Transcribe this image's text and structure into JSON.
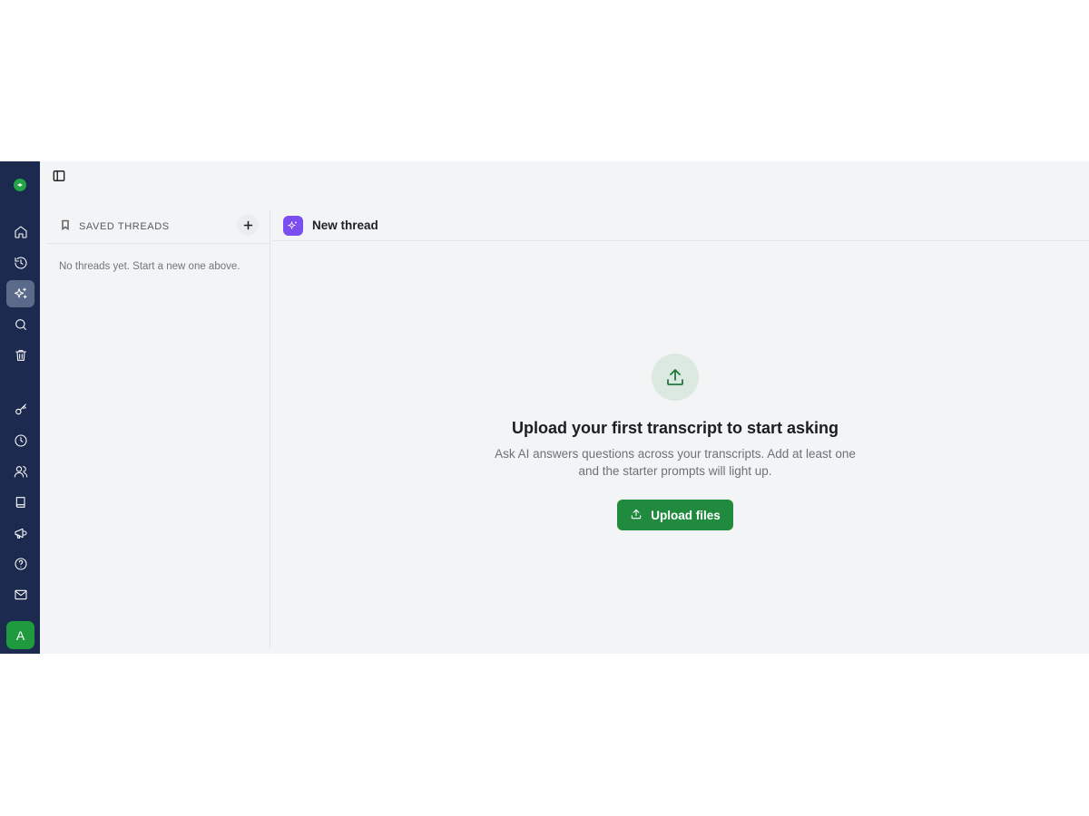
{
  "rail": {
    "avatar_initial": "A",
    "icons": [
      "logo-icon",
      "home-icon",
      "history-icon",
      "ai-sparkles-icon",
      "search-icon",
      "trash-icon",
      "key-icon",
      "clock-icon",
      "users-icon",
      "book-icon",
      "megaphone-icon",
      "help-icon",
      "mail-icon"
    ]
  },
  "threads": {
    "title": "SAVED THREADS",
    "empty_text": "No threads yet. Start a new one above."
  },
  "chat": {
    "title": "New thread",
    "empty_title": "Upload your first transcript to start asking",
    "empty_desc": "Ask AI answers questions across your transcripts. Add at least one and the starter prompts will light up.",
    "upload_label": "Upload files"
  },
  "colors": {
    "rail_bg": "#1b2a4e",
    "accent_green": "#208a3e",
    "accent_purple": "#7b4ef0"
  }
}
